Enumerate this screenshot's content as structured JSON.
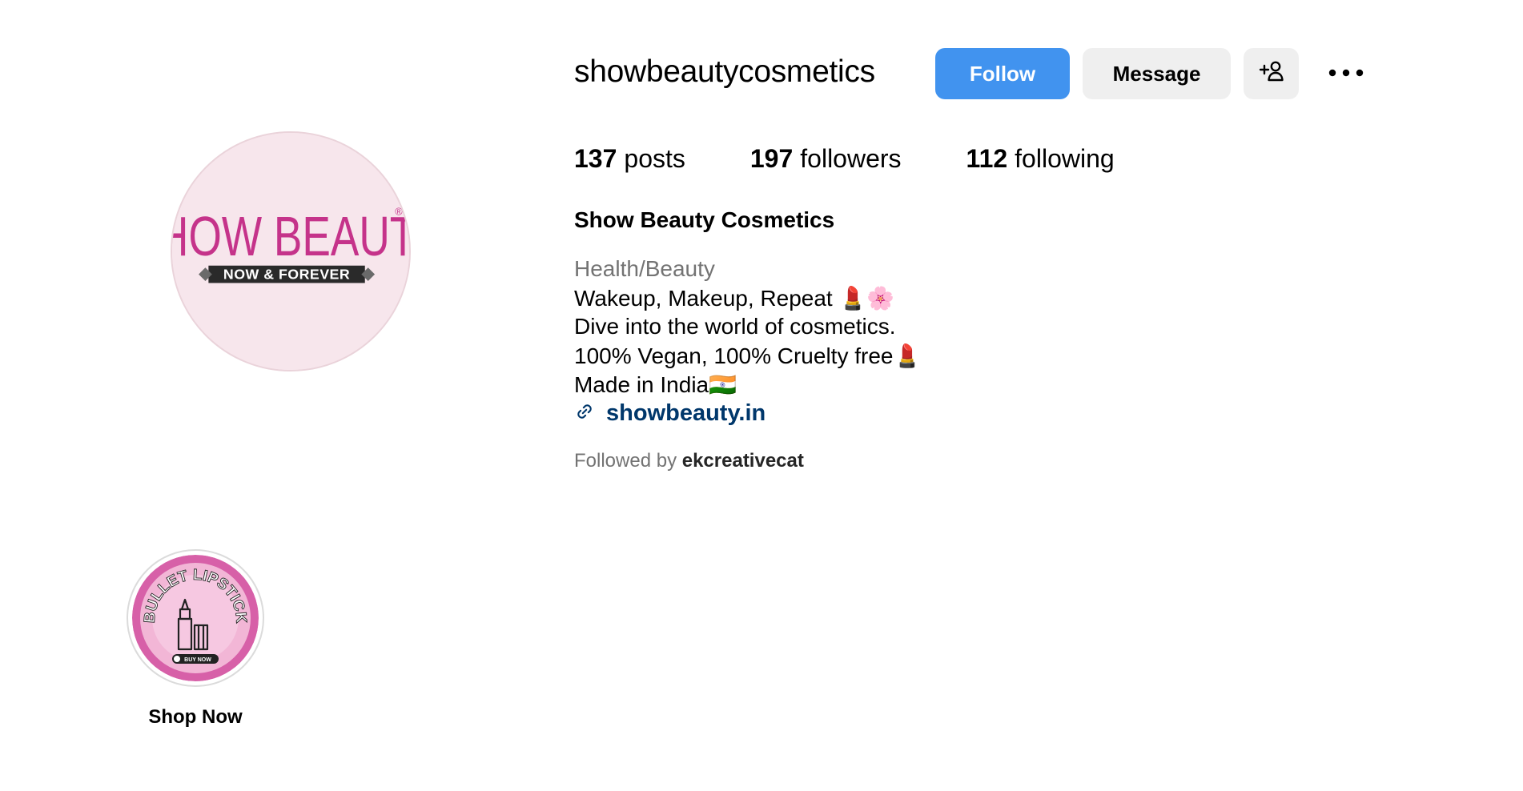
{
  "profile": {
    "username": "showbeautycosmetics",
    "avatar": {
      "brand_text": "SHOW BEAUTY",
      "registered_mark": "®",
      "tagline": "NOW & FOREVER",
      "brand_color": "#c5338a",
      "background_color": "#f7e6ec"
    }
  },
  "actions": {
    "follow_label": "Follow",
    "message_label": "Message",
    "add_user_icon": "person-add-icon",
    "more_icon": "more-options-icon"
  },
  "stats": {
    "posts_count": "137",
    "posts_label": "posts",
    "followers_count": "197",
    "followers_label": "followers",
    "following_count": "112",
    "following_label": "following"
  },
  "bio": {
    "display_name": "Show Beauty Cosmetics",
    "category": "Health/Beauty",
    "line1": "Wakeup, Makeup, Repeat 💄🌸",
    "line2": "Dive into the world of cosmetics.",
    "line3": "100% Vegan, 100% Cruelty free💄",
    "line4": "Made in India🇮🇳",
    "website": "showbeauty.in",
    "link_icon": "link-icon",
    "followed_by_prefix": "Followed by",
    "followed_by_user": "ekcreativecat"
  },
  "highlights": [
    {
      "label": "Shop Now",
      "cover_text": "BULLET LIPSTICK",
      "cover_button_text": "BUY NOW",
      "cover_icon": "lipstick-icon"
    }
  ],
  "colors": {
    "follow_button": "#4193ef",
    "secondary_button": "#efefef",
    "link_text": "#00376b",
    "muted_text": "#737373"
  }
}
